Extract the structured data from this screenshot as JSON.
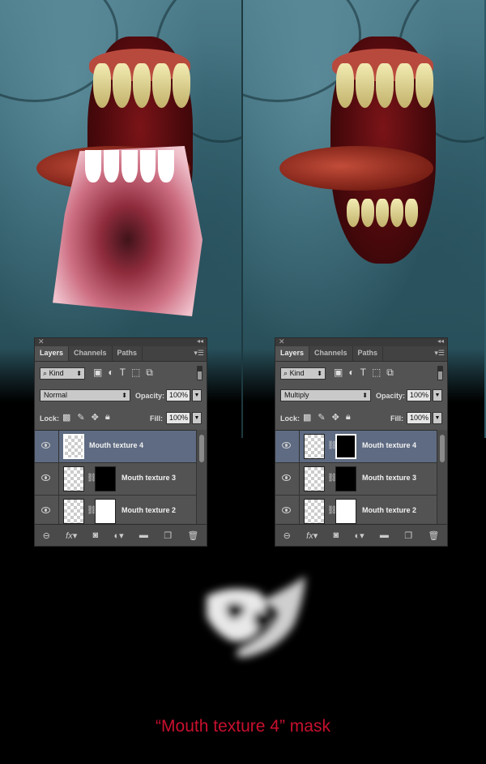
{
  "panels": [
    {
      "id": "left",
      "tabs": [
        "Layers",
        "Channels",
        "Paths"
      ],
      "active_tab": "Layers",
      "filter_kind": "Kind",
      "blend_mode": "Normal",
      "opacity_label": "Opacity:",
      "opacity": "100%",
      "lock_label": "Lock:",
      "fill_label": "Fill:",
      "fill": "100%",
      "layers": [
        {
          "name": "Mouth texture 4",
          "mask": "none",
          "selected": true
        },
        {
          "name": "Mouth texture 3",
          "mask": "black",
          "selected": false
        },
        {
          "name": "Mouth texture 2",
          "mask": "white",
          "selected": false
        }
      ]
    },
    {
      "id": "right",
      "tabs": [
        "Layers",
        "Channels",
        "Paths"
      ],
      "active_tab": "Layers",
      "filter_kind": "Kind",
      "blend_mode": "Multiply",
      "opacity_label": "Opacity:",
      "opacity": "100%",
      "lock_label": "Lock:",
      "fill_label": "Fill:",
      "fill": "100%",
      "layers": [
        {
          "name": "Mouth texture 4",
          "mask": "black",
          "selected": true
        },
        {
          "name": "Mouth texture 3",
          "mask": "black",
          "selected": false
        },
        {
          "name": "Mouth texture 2",
          "mask": "white",
          "selected": false
        }
      ]
    }
  ],
  "caption": "“Mouth texture 4” mask",
  "colors": {
    "caption": "#c8102e",
    "panel_bg": "#535353",
    "selected_layer": "#5e6b82",
    "skin": "#325f6c"
  }
}
